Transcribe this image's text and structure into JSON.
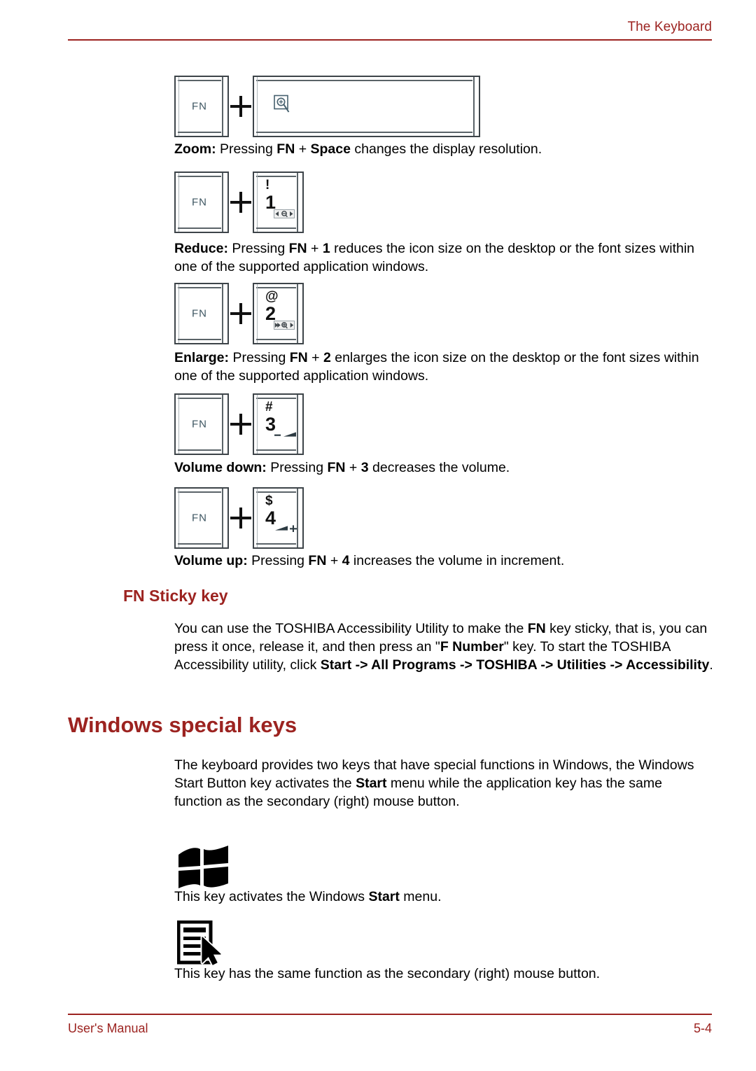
{
  "header": {
    "title": "The Keyboard"
  },
  "footer": {
    "manual_label": "User's Manual",
    "page_number": "5-4"
  },
  "colors": {
    "accent_red": "#9c2320",
    "key_outline": "#3d4449",
    "fn_text": "#3d5561"
  },
  "keys": {
    "fn_label": "FN",
    "space_icon": "zoom-magnifier-plus-icon",
    "one": {
      "symbol": "!",
      "digit": "1",
      "icon": "reduce-icon"
    },
    "two": {
      "symbol": "@",
      "digit": "2",
      "icon": "enlarge-icon"
    },
    "three": {
      "symbol": "#",
      "digit": "3",
      "icon": "volume-down-icon"
    },
    "four": {
      "symbol": "$",
      "digit": "4",
      "icon": "volume-up-icon"
    }
  },
  "entries": {
    "zoom": {
      "term": "Zoom:",
      "rest_a": " Pressing ",
      "fn": "FN",
      "plus": " + ",
      "key": "Space",
      "rest_b": " changes the display resolution."
    },
    "reduce": {
      "term": "Reduce:",
      "rest_a": " Pressing ",
      "fn": "FN",
      "plus": " + ",
      "key": "1",
      "rest_b": " reduces the icon size on the desktop or the font sizes within one of the supported application windows."
    },
    "enlarge": {
      "term": "Enlarge:",
      "rest_a": " Pressing ",
      "fn": "FN",
      "plus": " + ",
      "key": "2",
      "rest_b": " enlarges the icon size on the desktop or the font sizes within one of the supported application windows."
    },
    "volume_down": {
      "term": "Volume down:",
      "rest_a": " Pressing ",
      "fn": "FN",
      "plus": " + ",
      "key": "3",
      "rest_b": " decreases the volume."
    },
    "volume_up": {
      "term": "Volume up:",
      "rest_a": " Pressing ",
      "fn": "FN",
      "plus": " + ",
      "key": "4",
      "rest_b": " increases the volume in increment."
    }
  },
  "sticky": {
    "heading": "FN Sticky key",
    "p1_a": "You can use the TOSHIBA Accessibility Utility to make the ",
    "p1_fn": "FN",
    "p1_b": " key sticky, that is, you can press it once, release it, and then press an \"",
    "p1_fnumber": "F Number",
    "p1_c": "\" key. To start the TOSHIBA Accessibility utility, click ",
    "p1_start": "Start -> All Programs -> TOSHIBA -> Utilities -> Accessibility",
    "p1_d": "."
  },
  "windows_keys": {
    "heading": "Windows special keys",
    "intro_a": "The keyboard provides two keys that have special functions in Windows, the Windows Start Button key activates the ",
    "intro_start": "Start",
    "intro_b": " menu while the application key has the same function as the secondary (right) mouse button.",
    "start_key_icon": "windows-flag-icon",
    "start_key_caption_a": "This key activates the Windows ",
    "start_key_caption_bold": "Start",
    "start_key_caption_b": " menu.",
    "app_key_icon": "application-menu-cursor-icon",
    "app_key_caption": "This key has the same function as the secondary (right) mouse button."
  }
}
